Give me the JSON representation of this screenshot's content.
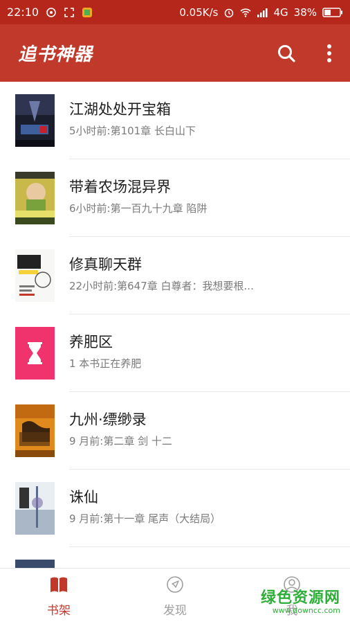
{
  "status": {
    "time": "22:10",
    "speed": "0.05K/s",
    "network": "4G",
    "battery": "38%"
  },
  "app": {
    "title": "追书神器"
  },
  "books": [
    {
      "title": "江湖处处开宝箱",
      "update": "5小时前:第101章 长白山下",
      "cover_icon": "cover-jianghu"
    },
    {
      "title": "带着农场混异界",
      "update": "6小时前:第一百九十九章 陷阱",
      "cover_icon": "cover-farm"
    },
    {
      "title": "修真聊天群",
      "update": "22小时前:第647章 白尊者：我想要根...",
      "cover_icon": "cover-chatgroup"
    },
    {
      "title": "养肥区",
      "update": "1 本书正在养肥",
      "cover_icon": "hourglass-icon"
    },
    {
      "title": "九州·缥缈录",
      "update": "9 月前:第二章 剑 十二",
      "cover_icon": "cover-jiuzhou"
    },
    {
      "title": "诛仙",
      "update": "9 月前:第十一章 尾声（大结局）",
      "cover_icon": "cover-zhuxian"
    }
  ],
  "tabs": [
    {
      "label": "书架",
      "icon": "book-icon",
      "active": true
    },
    {
      "label": "发现",
      "icon": "compass-icon",
      "active": false
    },
    {
      "label": "我",
      "icon": "person-icon",
      "active": false
    }
  ],
  "watermark": {
    "line1": "绿色资源网",
    "line2": "www.downcc.com"
  },
  "colors": {
    "primary": "#c0392b",
    "status_bar": "#b5271b",
    "tab_active": "#c0392b",
    "tab_inactive": "#9e9e9e",
    "feeding_cover": "#f0336c"
  }
}
